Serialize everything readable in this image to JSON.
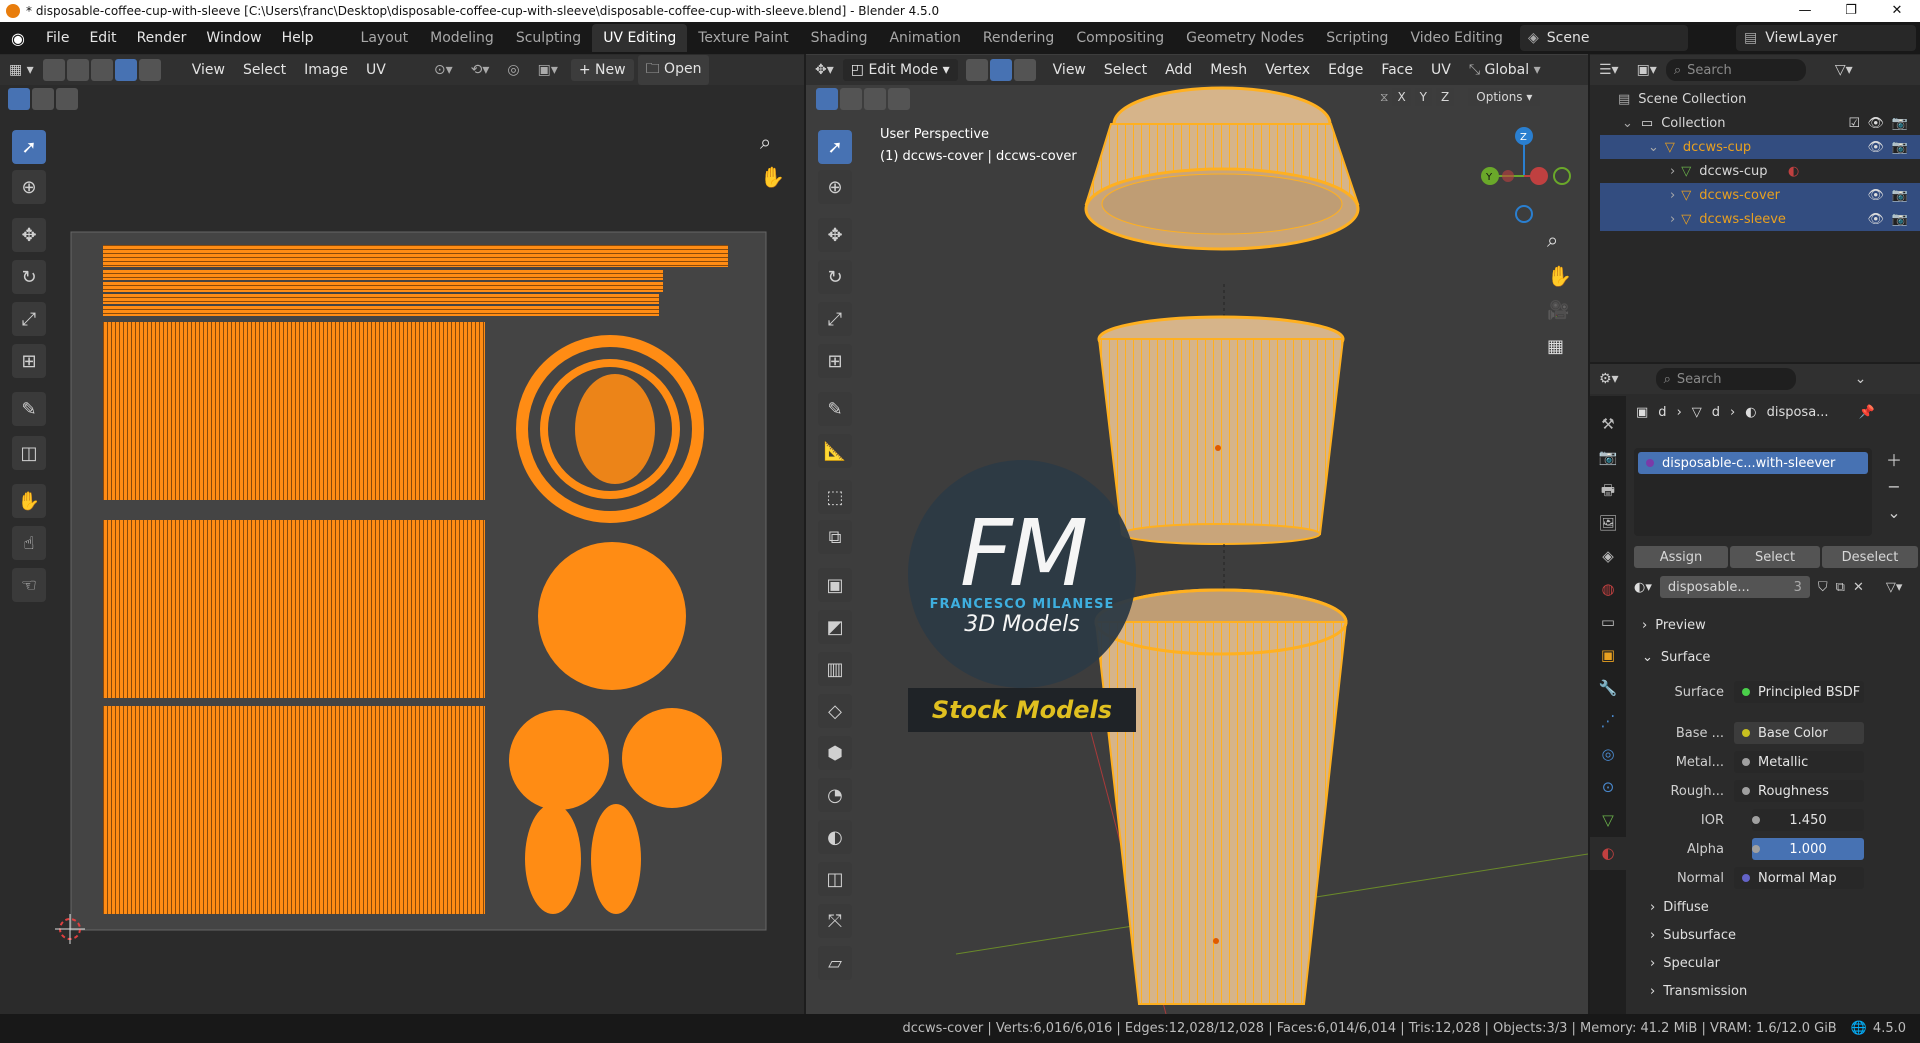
{
  "window": {
    "title": "* disposable-coffee-cup-with-sleeve [C:\\Users\\franc\\Desktop\\disposable-coffee-cup-with-sleeve\\disposable-coffee-cup-with-sleeve.blend] - Blender 4.5.0",
    "min": "—",
    "max": "❐",
    "close": "✕"
  },
  "menus": [
    "File",
    "Edit",
    "Render",
    "Window",
    "Help"
  ],
  "workspaces": [
    "Layout",
    "Modeling",
    "Sculpting",
    "UV Editing",
    "Texture Paint",
    "Shading",
    "Animation",
    "Rendering",
    "Compositing",
    "Geometry Nodes",
    "Scripting",
    "Video Editing"
  ],
  "workspace_add": "+",
  "scene": "Scene",
  "view_layer": "ViewLayer",
  "uv_editor": {
    "menus": [
      "View",
      "Select",
      "Image",
      "UV"
    ],
    "new_label": "New",
    "open_label": "Open",
    "new_prefix": "+"
  },
  "viewport": {
    "mode": "Edit Mode",
    "menus": [
      "View",
      "Select",
      "Add",
      "Mesh",
      "Vertex",
      "Edge",
      "Face",
      "UV"
    ],
    "orientation": "Global",
    "axes": [
      "X",
      "Y",
      "Z"
    ],
    "options": "Options",
    "perspective": "User Perspective",
    "object_info": "(1) dccws-cover | dccws-cover",
    "gizmo_z": "Z",
    "gizmo_y": "Y"
  },
  "watermark": {
    "logo": "FM",
    "name": "FRANCESCO MILANESE",
    "subtitle": "3D Models",
    "banner": "Stock Models"
  },
  "outliner": {
    "search": "Search",
    "scene_collection": "Scene Collection",
    "collection": "Collection",
    "items": [
      {
        "label": "dccws-cup",
        "level": 1,
        "selected": false,
        "color": "#e8a020"
      },
      {
        "label": "dccws-cup",
        "level": 2,
        "selected": false,
        "color": "#d8d8d8"
      },
      {
        "label": "dccws-cover",
        "level": 2,
        "selected": true,
        "color": "#e8a020"
      },
      {
        "label": "dccws-sleeve",
        "level": 2,
        "selected": true,
        "color": "#e8a020"
      }
    ]
  },
  "properties": {
    "search": "Search",
    "breadcrumb": [
      "d",
      "d",
      "disposa..."
    ],
    "material_slot": "disposable-c...with-sleever",
    "assign": "Assign",
    "select": "Select",
    "deselect": "Deselect",
    "material_name": "disposable...",
    "users": "3",
    "panels": {
      "preview": "Preview",
      "surface": "Surface"
    },
    "surface_label": "Surface",
    "surface_value": "Principled BSDF",
    "rows": [
      {
        "label": "Base ...",
        "value": "Base Color",
        "dot": "#c8c020"
      },
      {
        "label": "Metal...",
        "value": "Metallic",
        "dot": "#a0a0a0"
      },
      {
        "label": "Rough...",
        "value": "Roughness",
        "dot": "#a0a0a0"
      },
      {
        "label": "IOR",
        "value": "1.450",
        "dot": "#a0a0a0"
      },
      {
        "label": "Alpha",
        "value": "1.000",
        "dot": "#a0a0a0"
      },
      {
        "label": "Normal",
        "value": "Normal Map",
        "dot": "#6363c7"
      }
    ],
    "subpanels": [
      "Diffuse",
      "Subsurface",
      "Specular",
      "Transmission"
    ]
  },
  "status": "dccws-cover | Verts:6,016/6,016 | Edges:12,028/12,028 | Faces:6,014/6,014 | Tris:12,028 | Objects:3/3 | Memory: 41.2 MiB | VRAM: 1.6/12.0 GiB",
  "version": "4.5.0",
  "colors": {
    "accent": "#4772b3",
    "uv": "#ff8c14",
    "wire": "#ffb020"
  }
}
